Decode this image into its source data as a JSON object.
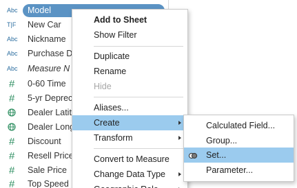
{
  "data_pane": {
    "fields": [
      {
        "type_icon": "Abc",
        "icon_name": "string-type-icon",
        "label": "Model",
        "selected": true
      },
      {
        "type_icon": "T|F",
        "icon_name": "boolean-type-icon",
        "label": "New Car"
      },
      {
        "type_icon": "Abc",
        "icon_name": "string-type-icon",
        "label": "Nickname"
      },
      {
        "type_icon": "Abc",
        "icon_name": "string-type-icon",
        "label": "Purchase D"
      },
      {
        "type_icon": "Abc",
        "icon_name": "string-type-icon",
        "label": "Measure N",
        "italic": true
      },
      {
        "type_icon": "#",
        "icon_name": "number-type-icon",
        "label": "0-60 Time"
      },
      {
        "type_icon": "#",
        "icon_name": "number-type-icon",
        "label": "5-yr Deprec"
      },
      {
        "type_icon": "globe",
        "icon_name": "globe-icon",
        "label": "Dealer Latit"
      },
      {
        "type_icon": "globe",
        "icon_name": "globe-icon",
        "label": "Dealer Long"
      },
      {
        "type_icon": "#",
        "icon_name": "number-type-icon",
        "label": "Discount"
      },
      {
        "type_icon": "#",
        "icon_name": "number-type-icon",
        "label": "Resell Price"
      },
      {
        "type_icon": "#",
        "icon_name": "number-type-icon",
        "label": "Sale Price"
      },
      {
        "type_icon": "#",
        "icon_name": "number-type-icon",
        "label": "Top Speed"
      }
    ]
  },
  "context_menu": {
    "add_to_sheet": "Add to Sheet",
    "show_filter": "Show Filter",
    "duplicate": "Duplicate",
    "rename": "Rename",
    "hide": "Hide",
    "aliases": "Aliases...",
    "create": "Create",
    "transform": "Transform",
    "convert_to_measure": "Convert to Measure",
    "change_data_type": "Change Data Type",
    "geographic_role": "Geographic Role"
  },
  "create_submenu": {
    "calculated_field": "Calculated Field...",
    "group": "Group...",
    "set": "Set...",
    "parameter": "Parameter..."
  },
  "colors": {
    "selection_pill": "#5b93c4",
    "menu_highlight": "#9bcbee",
    "string_icon": "#2c6ea0",
    "number_icon": "#2f8f62"
  }
}
